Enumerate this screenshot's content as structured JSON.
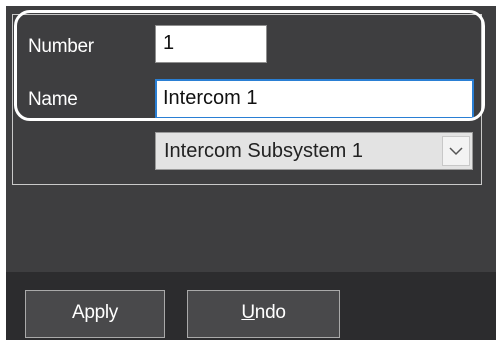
{
  "form": {
    "number_label": "Number",
    "number_value": "1",
    "name_label": "Name",
    "name_value": "Intercom 1",
    "subsystem_selected": "Intercom Subsystem 1"
  },
  "footer": {
    "apply_label": "Apply",
    "undo_mnemonic": "U",
    "undo_rest": "ndo"
  },
  "icons": {
    "dropdown": "chevron-down-icon"
  },
  "colors": {
    "background": "#3e3e40",
    "footer_background": "#2c2c2e",
    "focus_border": "#2a7fd4",
    "button_background": "#49494b"
  }
}
